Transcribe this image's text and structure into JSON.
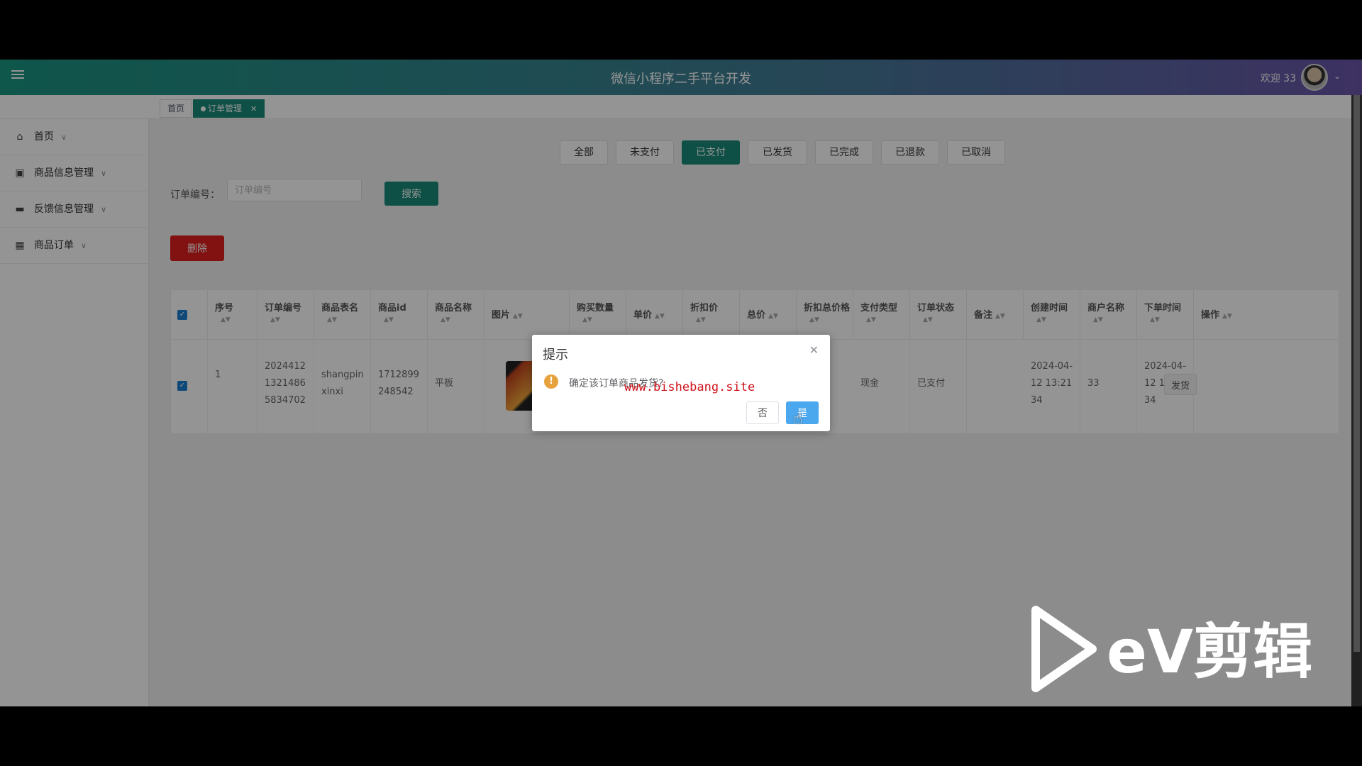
{
  "header": {
    "title": "微信小程序二手平台开发",
    "welcome": "欢迎 33"
  },
  "tabs": [
    {
      "label": "首页"
    },
    {
      "label": "订单管理"
    }
  ],
  "sidebar": {
    "items": [
      {
        "label": "首页",
        "icon": "home-icon"
      },
      {
        "label": "商品信息管理",
        "icon": "store-icon"
      },
      {
        "label": "反馈信息管理",
        "icon": "folder-icon"
      },
      {
        "label": "商品订单",
        "icon": "grid-icon"
      }
    ]
  },
  "filters": {
    "status_tabs": [
      "全部",
      "未支付",
      "已支付",
      "已发货",
      "已完成",
      "已退款",
      "已取消"
    ],
    "active_status": "已支付",
    "search_label": "订单编号：",
    "search_placeholder": "订单编号",
    "search_button": "搜索",
    "delete_button": "删除"
  },
  "table": {
    "columns": [
      "序号",
      "订单编号",
      "商品表名",
      "商品id",
      "商品名称",
      "图片",
      "购买数量",
      "单价",
      "折扣价",
      "总价",
      "折扣总价格",
      "支付类型",
      "订单状态",
      "备注",
      "创建时间",
      "商户名称",
      "下单时间",
      "操作"
    ],
    "rows": [
      {
        "index": "1",
        "order_no": "2024412\n1321486\n5834702",
        "table_name": "shangpin\nxinxi",
        "product_id": "1712899\n248542",
        "product_name": "平板",
        "pay_type": "现金",
        "status": "已支付",
        "created": "2024-04-\n12 13:21\n34",
        "merchant": "33",
        "order_time": "2024-04-\n12 13:21\n34",
        "action": "发货"
      }
    ]
  },
  "dialog": {
    "title": "提示",
    "message": "确定该订单商品发货?",
    "cancel": "否",
    "confirm": "是"
  },
  "overlay_text": {
    "watermark": "www.bishebang.site",
    "logo": "eV剪辑"
  }
}
